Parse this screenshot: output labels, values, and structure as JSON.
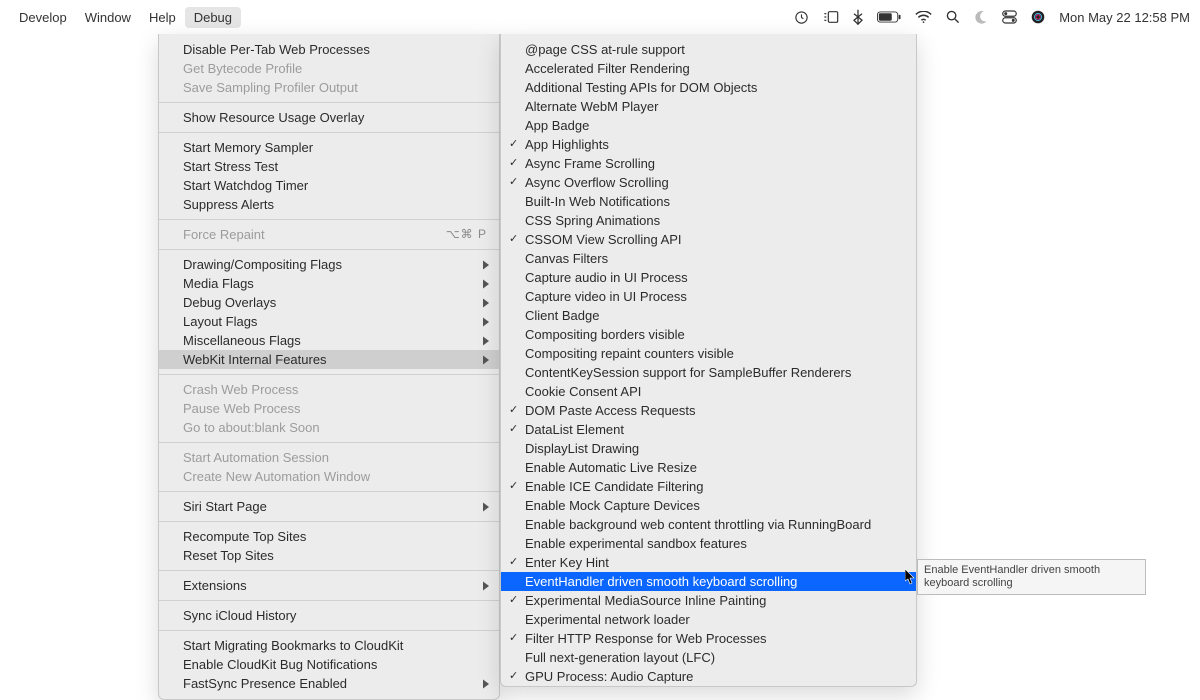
{
  "menubar": {
    "items": [
      "Develop",
      "Window",
      "Help",
      "Debug"
    ],
    "selected_index": 3,
    "clock": "Mon May 22  12:58 PM"
  },
  "left_panel": [
    {
      "type": "item",
      "label": "Disable Per-Tab Web Processes"
    },
    {
      "type": "item",
      "label": "Get Bytecode Profile",
      "disabled": true
    },
    {
      "type": "item",
      "label": "Save Sampling Profiler Output",
      "disabled": true
    },
    {
      "type": "sep"
    },
    {
      "type": "item",
      "label": "Show Resource Usage Overlay"
    },
    {
      "type": "sep"
    },
    {
      "type": "item",
      "label": "Start Memory Sampler"
    },
    {
      "type": "item",
      "label": "Start Stress Test"
    },
    {
      "type": "item",
      "label": "Start Watchdog Timer"
    },
    {
      "type": "item",
      "label": "Suppress Alerts"
    },
    {
      "type": "sep"
    },
    {
      "type": "item",
      "label": "Force Repaint",
      "disabled": true,
      "shortcut": "⌥⌘ P"
    },
    {
      "type": "sep"
    },
    {
      "type": "item",
      "label": "Drawing/Compositing Flags",
      "submenu": true
    },
    {
      "type": "item",
      "label": "Media Flags",
      "submenu": true
    },
    {
      "type": "item",
      "label": "Debug Overlays",
      "submenu": true
    },
    {
      "type": "item",
      "label": "Layout Flags",
      "submenu": true
    },
    {
      "type": "item",
      "label": "Miscellaneous Flags",
      "submenu": true
    },
    {
      "type": "item",
      "label": "WebKit Internal Features",
      "submenu": true,
      "highlight": true
    },
    {
      "type": "sep"
    },
    {
      "type": "item",
      "label": "Crash Web Process",
      "disabled": true
    },
    {
      "type": "item",
      "label": "Pause Web Process",
      "disabled": true
    },
    {
      "type": "item",
      "label": "Go to about:blank Soon",
      "disabled": true
    },
    {
      "type": "sep"
    },
    {
      "type": "item",
      "label": "Start Automation Session",
      "disabled": true
    },
    {
      "type": "item",
      "label": "Create New Automation Window",
      "disabled": true
    },
    {
      "type": "sep"
    },
    {
      "type": "item",
      "label": "Siri Start Page",
      "submenu": true
    },
    {
      "type": "sep"
    },
    {
      "type": "item",
      "label": "Recompute Top Sites"
    },
    {
      "type": "item",
      "label": "Reset Top Sites"
    },
    {
      "type": "sep"
    },
    {
      "type": "item",
      "label": "Extensions",
      "submenu": true
    },
    {
      "type": "sep"
    },
    {
      "type": "item",
      "label": "Sync iCloud History"
    },
    {
      "type": "sep"
    },
    {
      "type": "item",
      "label": "Start Migrating Bookmarks to CloudKit"
    },
    {
      "type": "item",
      "label": "Enable CloudKit Bug Notifications"
    },
    {
      "type": "item",
      "label": "FastSync Presence Enabled",
      "submenu": true
    }
  ],
  "right_panel": [
    {
      "label": "@page CSS at-rule support"
    },
    {
      "label": "Accelerated Filter Rendering"
    },
    {
      "label": "Additional Testing APIs for DOM Objects"
    },
    {
      "label": "Alternate WebM Player"
    },
    {
      "label": "App Badge"
    },
    {
      "label": "App Highlights",
      "checked": true
    },
    {
      "label": "Async Frame Scrolling",
      "checked": true
    },
    {
      "label": "Async Overflow Scrolling",
      "checked": true
    },
    {
      "label": "Built-In Web Notifications"
    },
    {
      "label": "CSS Spring Animations"
    },
    {
      "label": "CSSOM View Scrolling API",
      "checked": true
    },
    {
      "label": "Canvas Filters"
    },
    {
      "label": "Capture audio in UI Process"
    },
    {
      "label": "Capture video in UI Process"
    },
    {
      "label": "Client Badge"
    },
    {
      "label": "Compositing borders visible"
    },
    {
      "label": "Compositing repaint counters visible"
    },
    {
      "label": "ContentKeySession support for SampleBuffer Renderers"
    },
    {
      "label": "Cookie Consent API"
    },
    {
      "label": "DOM Paste Access Requests",
      "checked": true
    },
    {
      "label": "DataList Element",
      "checked": true
    },
    {
      "label": "DisplayList Drawing"
    },
    {
      "label": "Enable Automatic Live Resize"
    },
    {
      "label": "Enable ICE Candidate Filtering",
      "checked": true
    },
    {
      "label": "Enable Mock Capture Devices"
    },
    {
      "label": "Enable background web content throttling via RunningBoard"
    },
    {
      "label": "Enable experimental sandbox features"
    },
    {
      "label": "Enter Key Hint",
      "checked": true
    },
    {
      "label": "EventHandler driven smooth keyboard scrolling",
      "selected": true
    },
    {
      "label": "Experimental MediaSource Inline Painting",
      "checked": true
    },
    {
      "label": "Experimental network loader"
    },
    {
      "label": "Filter HTTP Response for Web Processes",
      "checked": true
    },
    {
      "label": "Full next-generation layout (LFC)"
    },
    {
      "label": "GPU Process: Audio Capture",
      "checked": true
    }
  ],
  "tooltip": "Enable EventHandler driven smooth keyboard scrolling"
}
